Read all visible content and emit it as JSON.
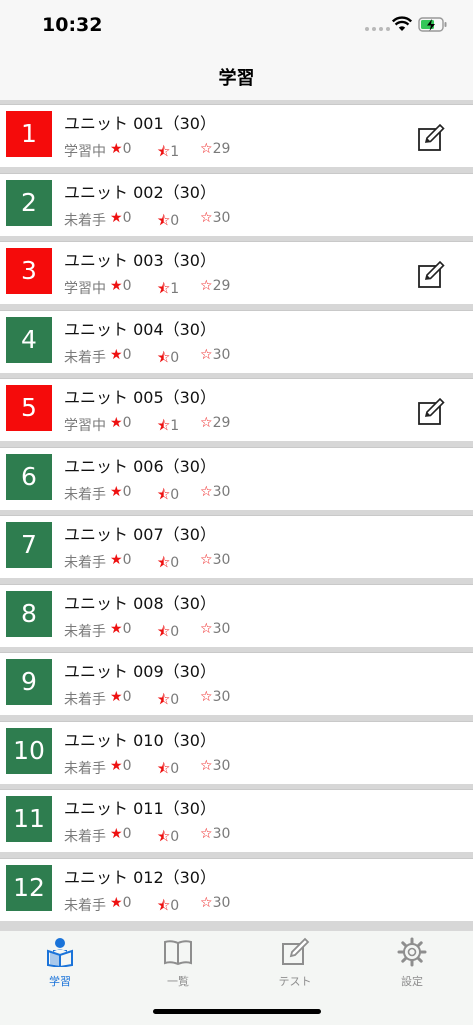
{
  "status_bar": {
    "time": "10:32"
  },
  "header": {
    "title": "学習"
  },
  "units": [
    {
      "num": "1",
      "title": "ユニット 001（30）",
      "status": "学習中",
      "red": "0",
      "half": "1",
      "empty": "29",
      "state": "in-progress"
    },
    {
      "num": "2",
      "title": "ユニット 002（30）",
      "status": "未着手",
      "red": "0",
      "half": "0",
      "empty": "30",
      "state": "not-started"
    },
    {
      "num": "3",
      "title": "ユニット 003（30）",
      "status": "学習中",
      "red": "0",
      "half": "1",
      "empty": "29",
      "state": "in-progress"
    },
    {
      "num": "4",
      "title": "ユニット 004（30）",
      "status": "未着手",
      "red": "0",
      "half": "0",
      "empty": "30",
      "state": "not-started"
    },
    {
      "num": "5",
      "title": "ユニット 005（30）",
      "status": "学習中",
      "red": "0",
      "half": "1",
      "empty": "29",
      "state": "in-progress"
    },
    {
      "num": "6",
      "title": "ユニット 006（30）",
      "status": "未着手",
      "red": "0",
      "half": "0",
      "empty": "30",
      "state": "not-started"
    },
    {
      "num": "7",
      "title": "ユニット 007（30）",
      "status": "未着手",
      "red": "0",
      "half": "0",
      "empty": "30",
      "state": "not-started"
    },
    {
      "num": "8",
      "title": "ユニット 008（30）",
      "status": "未着手",
      "red": "0",
      "half": "0",
      "empty": "30",
      "state": "not-started"
    },
    {
      "num": "9",
      "title": "ユニット 009（30）",
      "status": "未着手",
      "red": "0",
      "half": "0",
      "empty": "30",
      "state": "not-started"
    },
    {
      "num": "10",
      "title": "ユニット 010（30）",
      "status": "未着手",
      "red": "0",
      "half": "0",
      "empty": "30",
      "state": "not-started"
    },
    {
      "num": "11",
      "title": "ユニット 011（30）",
      "status": "未着手",
      "red": "0",
      "half": "0",
      "empty": "30",
      "state": "not-started"
    },
    {
      "num": "12",
      "title": "ユニット 012（30）",
      "status": "未着手",
      "red": "0",
      "half": "0",
      "empty": "30",
      "state": "not-started"
    }
  ],
  "tabs": [
    {
      "label": "学習",
      "icon": "person-book-icon",
      "active": true
    },
    {
      "label": "一覧",
      "icon": "book-icon",
      "active": false
    },
    {
      "label": "テスト",
      "icon": "pencil-icon",
      "active": false
    },
    {
      "label": "設定",
      "icon": "gear-icon",
      "active": false
    }
  ],
  "colors": {
    "in_progress": "#f50b0b",
    "not_started": "#2e7d4f",
    "tab_active": "#1a73d9",
    "tab_inactive": "#8e8e8e"
  }
}
